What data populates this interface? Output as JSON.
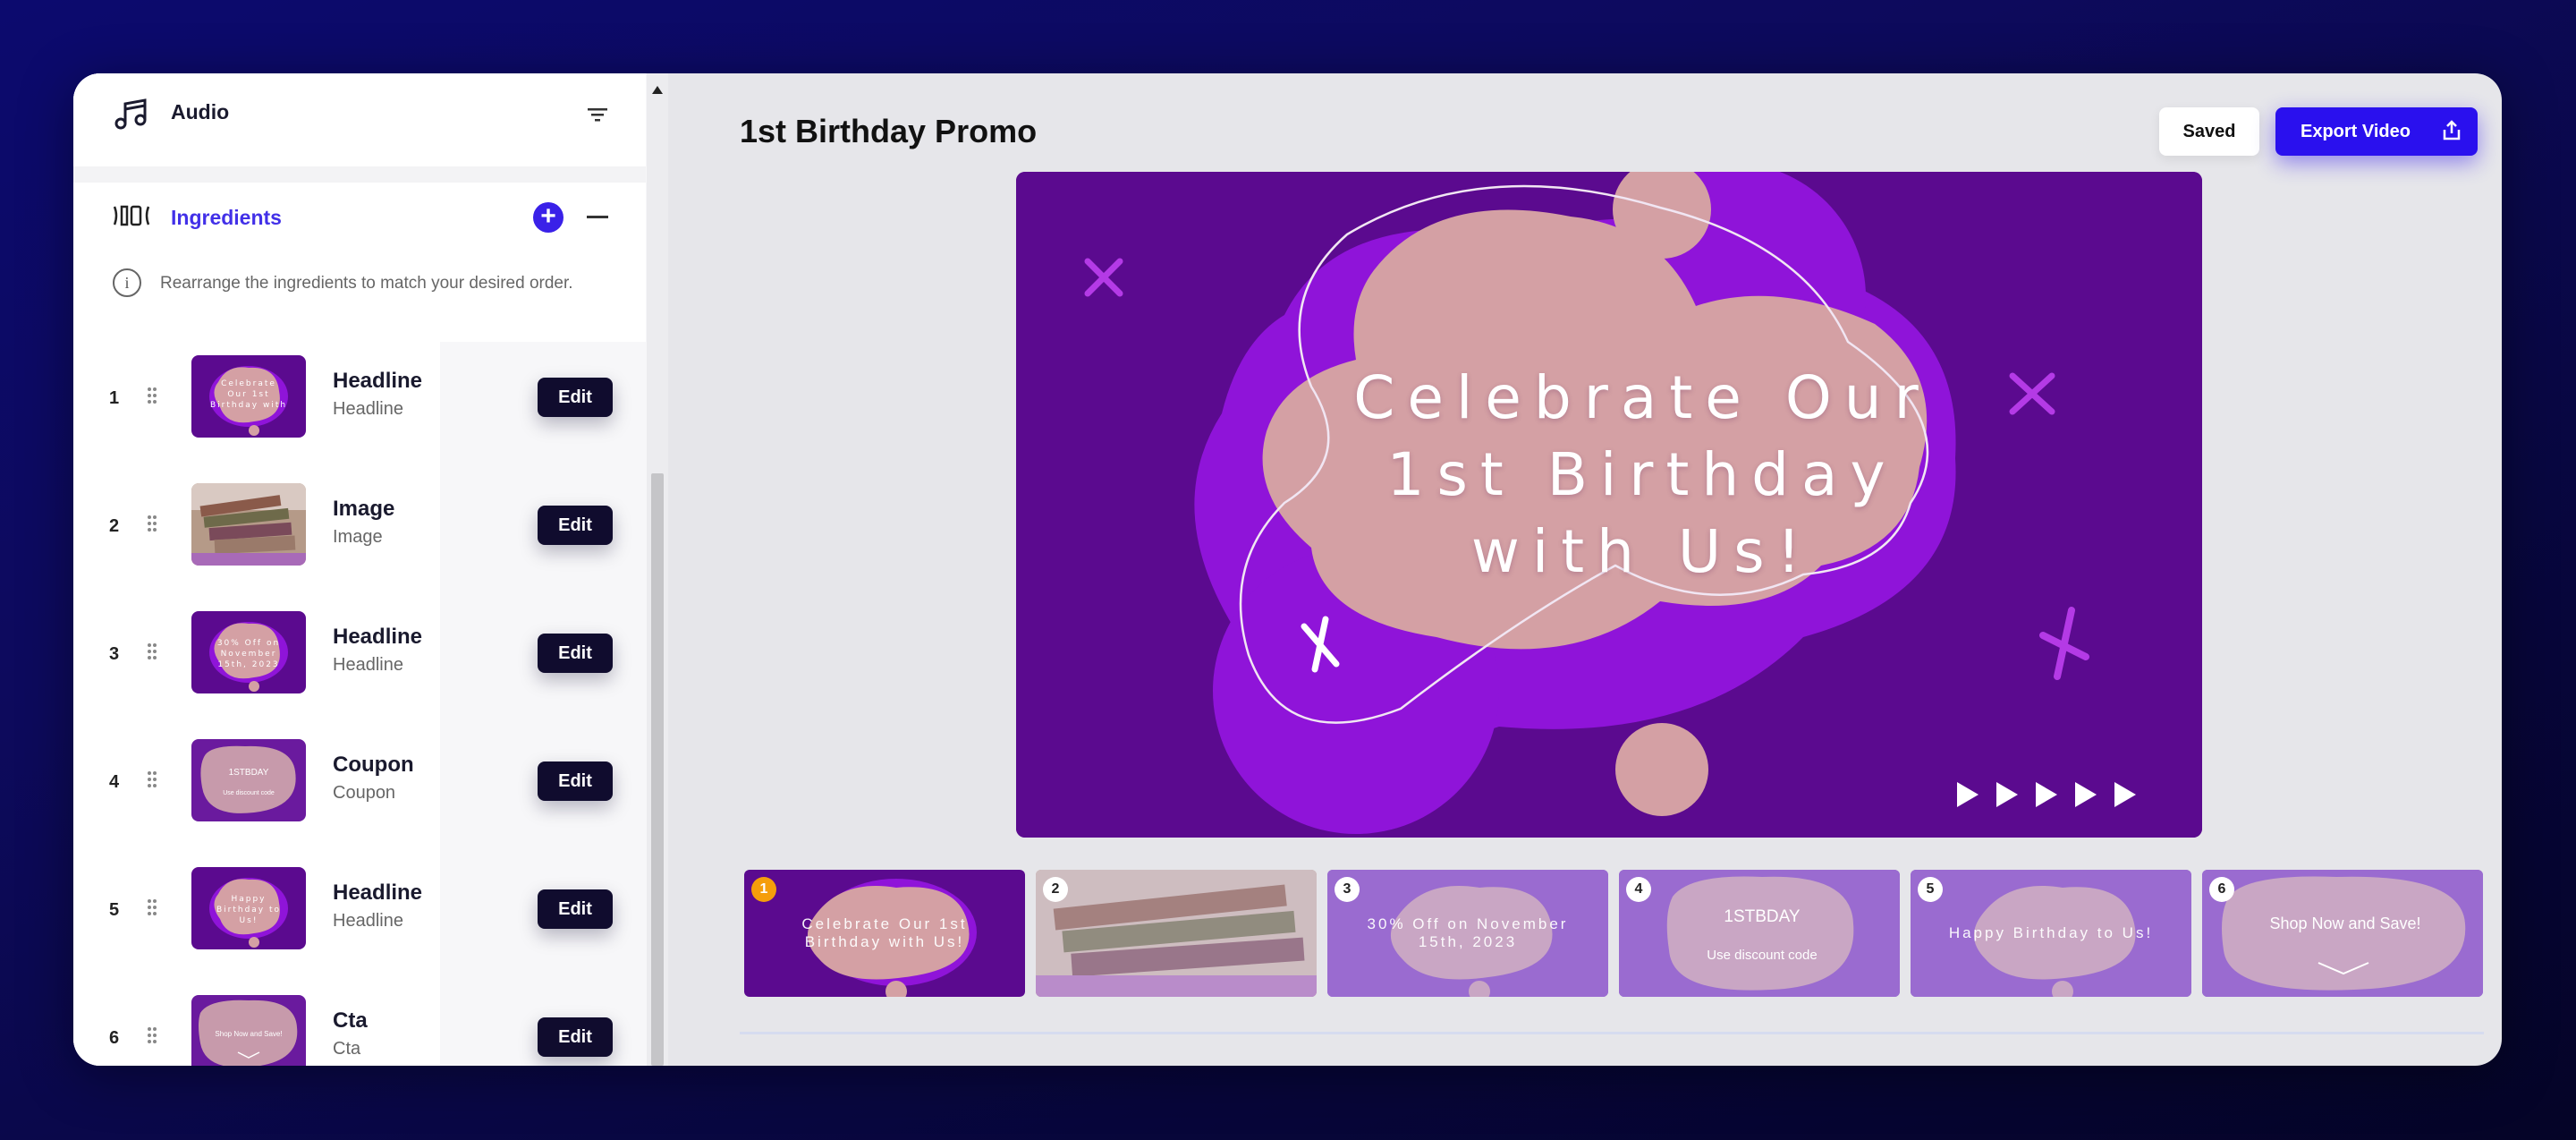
{
  "sidebar": {
    "audio_label": "Audio",
    "ingredients_label": "Ingredients",
    "info_text": "Rearrange the ingredients to match your desired order.",
    "rows": [
      {
        "num": "1",
        "title": "Headline",
        "sub": "Headline",
        "edit": "Edit",
        "thumb_text": "Celebrate Our 1st Birthday with Us!"
      },
      {
        "num": "2",
        "title": "Image",
        "sub": "Image",
        "edit": "Edit"
      },
      {
        "num": "3",
        "title": "Headline",
        "sub": "Headline",
        "edit": "Edit",
        "thumb_text": "30% Off on November 15th, 2023"
      },
      {
        "num": "4",
        "title": "Coupon",
        "sub": "Coupon",
        "edit": "Edit",
        "thumb_text": "1STBDAY",
        "thumb_sub": "Use discount code"
      },
      {
        "num": "5",
        "title": "Headline",
        "sub": "Headline",
        "edit": "Edit",
        "thumb_text": "Happy Birthday to Us!"
      },
      {
        "num": "6",
        "title": "Cta",
        "sub": "Cta",
        "edit": "Edit",
        "thumb_text": "Shop Now and Save!"
      }
    ]
  },
  "header": {
    "title": "1st Birthday Promo",
    "saved_label": "Saved",
    "export_label": "Export Video"
  },
  "preview": {
    "headline": "Celebrate Our 1st Birthday with Us!"
  },
  "timeline": {
    "clips": [
      {
        "num": "1",
        "text": "Celebrate Our 1st Birthday with Us!",
        "active": true
      },
      {
        "num": "2",
        "text": ""
      },
      {
        "num": "3",
        "text": "30% Off on November 15th, 2023"
      },
      {
        "num": "4",
        "text": "1STBDAY",
        "sub": "Use discount code"
      },
      {
        "num": "5",
        "text": "Happy Birthday to Us!"
      },
      {
        "num": "6",
        "text": "Shop Now and Save!"
      }
    ]
  },
  "colors": {
    "accent": "#2a10ee",
    "ingredients_label": "#4230e8",
    "preview_bg": "#5b0a8f",
    "blob_purple": "#8f14d9",
    "blob_peach": "#d4a0a4",
    "badge_active": "#f59e0b",
    "edit_button": "#100c2e"
  },
  "icons": {
    "audio": "music-note-icon",
    "filter": "filter-icon",
    "ingredients": "ingredients-icon",
    "add": "plus-circle-icon",
    "collapse": "minus-icon",
    "info": "info-icon",
    "drag": "drag-handle-icon",
    "export": "upload-icon"
  }
}
